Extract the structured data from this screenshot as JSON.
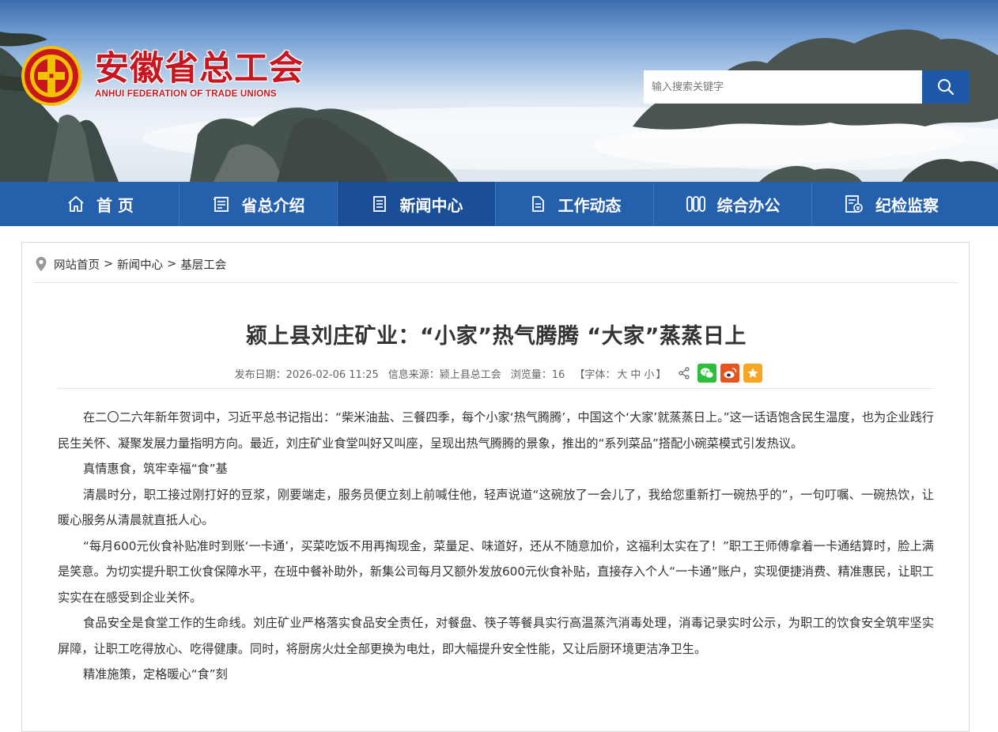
{
  "header": {
    "org_name_cn": "安徽省总工会",
    "org_name_en": "ANHUI FEDERATION OF TRADE UNIONS",
    "logo_icon": "trade-union-emblem-icon",
    "search": {
      "placeholder": "输入搜索关键字",
      "icon": "search-icon"
    }
  },
  "nav": {
    "items": [
      {
        "label": "首 页",
        "icon": "home-icon"
      },
      {
        "label": "省总介绍",
        "icon": "intro-icon"
      },
      {
        "label": "新闻中心",
        "icon": "news-icon"
      },
      {
        "label": "工作动态",
        "icon": "document-icon"
      },
      {
        "label": "综合办公",
        "icon": "office-icon"
      },
      {
        "label": "纪检监察",
        "icon": "supervision-icon"
      }
    ],
    "active_index": 2
  },
  "breadcrumb": {
    "icon": "location-pin-icon",
    "items": [
      "网站首页",
      "新闻中心",
      "基层工会"
    ],
    "separator": ">"
  },
  "article": {
    "title": "颍上县刘庄矿业：“小家”热气腾腾  “大家”蒸蒸日上",
    "meta": {
      "date": "发布日期：2026-02-06 11:25",
      "source": "信息来源：颍上县总工会",
      "views": "浏览量：16",
      "font_prefix": "【字体：",
      "font_large": "大",
      "font_medium": "中",
      "font_small": "小",
      "font_suffix": "】"
    },
    "share_icons": [
      "share-icon",
      "wechat-icon",
      "weibo-icon",
      "qzone-icon"
    ],
    "share_colors": {
      "wechat": "#2dbe3c",
      "weibo": "#e8541e",
      "qzone": "#f5a623"
    },
    "paragraphs": [
      "在二〇二六年新年贺词中，习近平总书记指出：“柴米油盐、三餐四季，每个小家‘热气腾腾’，中国这个‘大家’就蒸蒸日上。”这一话语饱含民生温度，也为企业践行民生关怀、凝聚发展力量指明方向。最近，刘庄矿业食堂叫好又叫座，呈现出热气腾腾的景象，推出的“系列菜品”搭配小碗菜模式引发热议。",
      "真情惠食，筑牢幸福“食”基",
      "清晨时分，职工接过刚打好的豆浆，刚要端走，服务员便立刻上前喊住他，轻声说道“这碗放了一会儿了，我给您重新打一碗热乎的”，一句叮嘱、一碗热饮，让暖心服务从清晨就直抵人心。",
      "“每月600元伙食补贴准时到账‘一卡通’，买菜吃饭不用再掏现金，菜量足、味道好，还从不随意加价，这福利太实在了！”职工王师傅拿着一卡通结算时，脸上满是笑意。为切实提升职工伙食保障水平，在班中餐补助外，新集公司每月又额外发放600元伙食补贴，直接存入个人“一卡通”账户，实现便捷消费、精准惠民，让职工实实在在感受到企业关怀。",
      "食品安全是食堂工作的生命线。刘庄矿业严格落实食品安全责任，对餐盘、筷子等餐具实行高温蒸汽消毒处理，消毒记录实时公示，为职工的饮食安全筑牢坚实屏障，让职工吃得放心、吃得健康。同时，将厨房火灶全部更换为电灶，即大幅提升安全性能，又让后厨环境更洁净卫生。",
      "精准施策，定格暖心“食”刻"
    ]
  },
  "colors": {
    "brand_red": "#c9151e",
    "nav_blue": "#2460ac",
    "nav_active": "#1a4e97",
    "search_button": "#1f58a8"
  }
}
